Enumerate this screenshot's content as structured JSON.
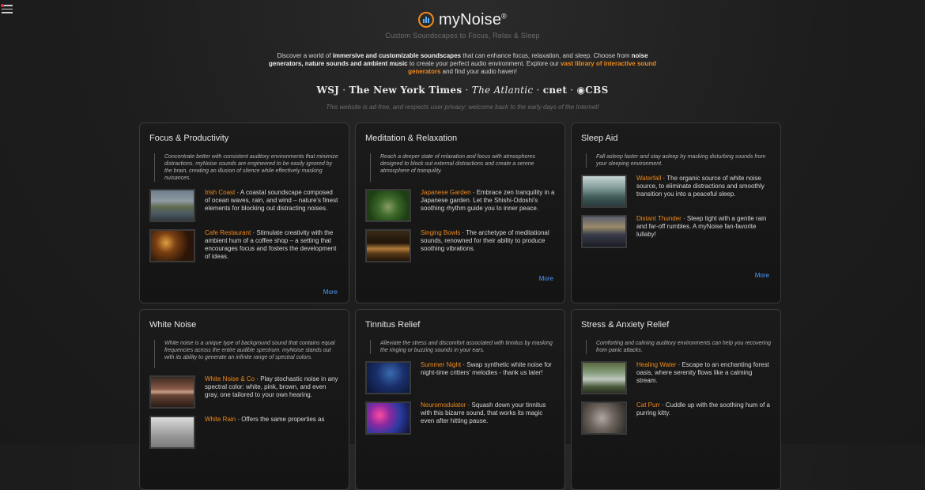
{
  "nav": {
    "menu_icon": "hamburger-menu-icon"
  },
  "header": {
    "logo_text": "myNoise",
    "logo_reg": "®",
    "tagline": "Custom Soundscapes to Focus, Relax & Sleep"
  },
  "intro": {
    "p1": "Discover a world of ",
    "b1": "immersive and customizable soundscapes",
    "p2": " that can enhance focus, relaxation, and sleep. Choose from ",
    "b2": "noise generators, nature sounds and ambient music",
    "p3": " to create your perfect audio environment. Explore our ",
    "link": "vast library of interactive sound generators",
    "p4": " and find your audio haven!"
  },
  "press": {
    "wsj": "WSJ",
    "sep1": " · ",
    "nyt": "The New York Times",
    "sep2": " · ",
    "atlantic": "The Atlantic",
    "sep3": " · ",
    "cnet": "cnet",
    "sep4": " · ",
    "cbs": "◉CBS"
  },
  "adfree": "This website is ad-free, and respects user privacy: welcome back to the early days of the Internet!",
  "cards": [
    {
      "title": "Focus & Productivity",
      "desc": "Concentrate better with consistent auditory environments that minimize distractions. myNoise sounds are engineered to be easily ignored by the brain, creating an illusion of silence while effectively masking nuisances.",
      "items": [
        {
          "name": "Irish Coast",
          "sep": " · ",
          "text": "A coastal soundscape composed of ocean waves, rain, and wind – nature's finest elements for blocking out distracting noises."
        },
        {
          "name": "Cafe Restaurant",
          "sep": " · ",
          "text": "Stimulate creativity with the ambient hum of a coffee shop – a setting that encourages focus and fosters the development of ideas."
        }
      ],
      "more": "More"
    },
    {
      "title": "Meditation & Relaxation",
      "desc": "Reach a deeper state of relaxation and focus with atmospheres designed to block out external distractions and create a serene atmosphere of tranquility.",
      "items": [
        {
          "name": "Japanese Garden",
          "sep": " · ",
          "text": "Embrace zen tranquility in a Japanese garden. Let the Shishi-Odoshi's soothing rhythm guide you to inner peace."
        },
        {
          "name": "Singing Bowls",
          "sep": " · ",
          "text": "The archetype of meditational sounds, renowned for their ability to produce soothing vibrations."
        }
      ],
      "more": "More"
    },
    {
      "title": "Sleep Aid",
      "desc": "Fall asleep faster and stay asleep by masking disturbing sounds from your sleeping environment.",
      "items": [
        {
          "name": "Waterfall",
          "sep": " · ",
          "text": "The organic source of white noise source, to eliminate distractions and smoothly transition you into a peaceful sleep."
        },
        {
          "name": "Distant Thunder",
          "sep": " · ",
          "text": "Sleep tight with a gentle rain and far-off rumbles. A myNoise fan-favorite lullaby!"
        }
      ],
      "more": "More"
    },
    {
      "title": "White Noise",
      "desc": "White noise is a unique type of background sound that contains equal frequencies across the entire audible spectrum. myNoise stands out with its ability to generate an infinite range of spectral colors.",
      "items": [
        {
          "name": "White Noise & Co",
          "sep": " · ",
          "text": "Play stochastic noise in any spectral color: white, pink, brown, and even gray, one tailored to your own hearing."
        },
        {
          "name": "White Rain",
          "sep": " · ",
          "text": "Offers the same properties as"
        }
      ]
    },
    {
      "title": "Tinnitus Relief",
      "desc": "Alleviate the stress and discomfort associated with tinnitus by masking the ringing or buzzing sounds in your ears.",
      "items": [
        {
          "name": "Summer Night",
          "sep": " · ",
          "text": "Swap synthetic white noise for night-time critters' melodies - thank us later!"
        },
        {
          "name": "Neuromodulator",
          "sep": " · ",
          "text": "Squash down your tinnitus with this bizarre sound, that works its magic even after hitting pause."
        }
      ]
    },
    {
      "title": "Stress & Anxiety Relief",
      "desc": "Comforting and calming auditory environments can help you recovering from panic attacks.",
      "items": [
        {
          "name": "Healing Water",
          "sep": " · ",
          "text": "Escape to an enchanting forest oasis, where serenity flows like a calming stream."
        },
        {
          "name": "Cat Purr",
          "sep": " · ",
          "text": "Cuddle up with the soothing hum of a purring kitty."
        }
      ]
    }
  ],
  "colors": {
    "accent_orange": "#f08a1c",
    "link_blue": "#4b9bff",
    "logo_blue": "#5ab0ff"
  }
}
